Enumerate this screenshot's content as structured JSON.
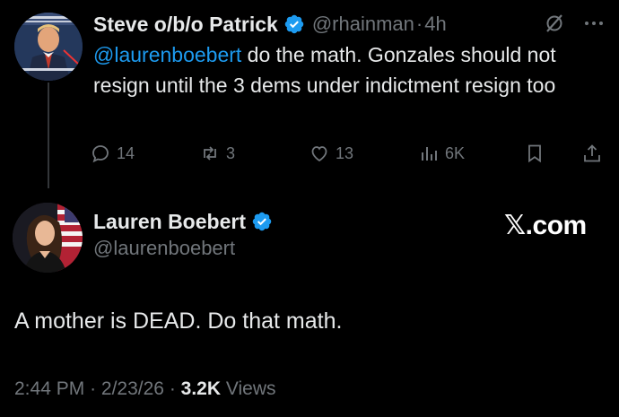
{
  "reply": {
    "name": "Steve o/b/o Patrick",
    "handle": "@rhainman",
    "sep": "·",
    "time": "4h",
    "mention": "@laurenboebert",
    "text": " do the math. Gonzales should not resign until the 3 dems under indictment resign too",
    "stats": {
      "replies": "14",
      "reposts": "3",
      "likes": "13",
      "views": "6K"
    }
  },
  "main": {
    "name": "Lauren Boebert",
    "handle": "@laurenboebert",
    "text": "A mother is DEAD. Do that math.",
    "time": "2:44 PM",
    "date": "2/23/26",
    "sep": "·",
    "views_count": "3.2K",
    "views_label": "Views"
  },
  "watermark": {
    "x": "𝕏",
    "domain": ".com"
  },
  "colors": {
    "accent": "#1d9bf0",
    "muted": "#71767b",
    "text": "#e7e9ea",
    "background": "#000000"
  },
  "icons": [
    "reply-icon",
    "repost-icon",
    "like-icon",
    "views-icon",
    "bookmark-icon",
    "share-icon",
    "verified-badge-icon",
    "grok-icon",
    "more-icon"
  ]
}
